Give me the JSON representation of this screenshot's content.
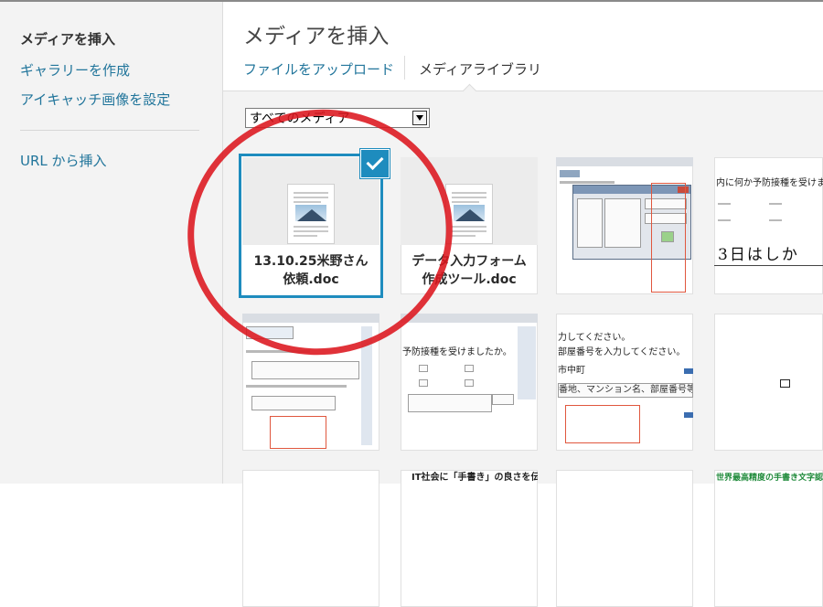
{
  "sidebar": {
    "items": [
      {
        "label": "メディアを挿入",
        "active": true
      },
      {
        "label": "ギャラリーを作成",
        "active": false
      },
      {
        "label": "アイキャッチ画像を設定",
        "active": false
      },
      {
        "label": "URL から挿入",
        "active": false
      }
    ]
  },
  "main": {
    "title": "メディアを挿入",
    "tabs": [
      {
        "label": "ファイルをアップロード",
        "active": false
      },
      {
        "label": "メディアライブラリ",
        "active": true
      }
    ],
    "filter": {
      "selected": "すべてのメディア"
    }
  },
  "attachments": [
    {
      "type": "document",
      "filename": "13.10.25米野さん依頼.doc",
      "selected": true
    },
    {
      "type": "document",
      "filename": "データ入力フォーム作成ツール.doc",
      "selected": false
    },
    {
      "type": "image",
      "kind": "form-dialog-screenshot"
    },
    {
      "type": "image",
      "kind": "handwriting-form",
      "texts": [
        "内に何か予防接種を受けましたか。",
        "3日はしか"
      ]
    },
    {
      "type": "image",
      "kind": "form-screenshot"
    },
    {
      "type": "image",
      "kind": "checkbox-form",
      "texts": [
        "予防接種を受けましたか。"
      ]
    },
    {
      "type": "image",
      "kind": "address-form",
      "texts": [
        "力してください。",
        "部屋番号を入力してください。",
        "市中町",
        "番地、マンション名、部屋番号等を入力してくださ"
      ]
    },
    {
      "type": "image",
      "kind": "blank-small-icon"
    },
    {
      "type": "image",
      "kind": "partial"
    },
    {
      "type": "image",
      "kind": "partial",
      "texts": [
        "IT社会に「手書き」の良さを伝える"
      ]
    },
    {
      "type": "image",
      "kind": "partial"
    },
    {
      "type": "image",
      "kind": "partial-banner",
      "texts": [
        "世界最高精度の手書き文字認識技術を"
      ]
    }
  ],
  "colors": {
    "link": "#21759b",
    "selection": "#1e8cbe",
    "annotation_circle": "#dc161e",
    "panel_bg": "#f3f3f3"
  }
}
